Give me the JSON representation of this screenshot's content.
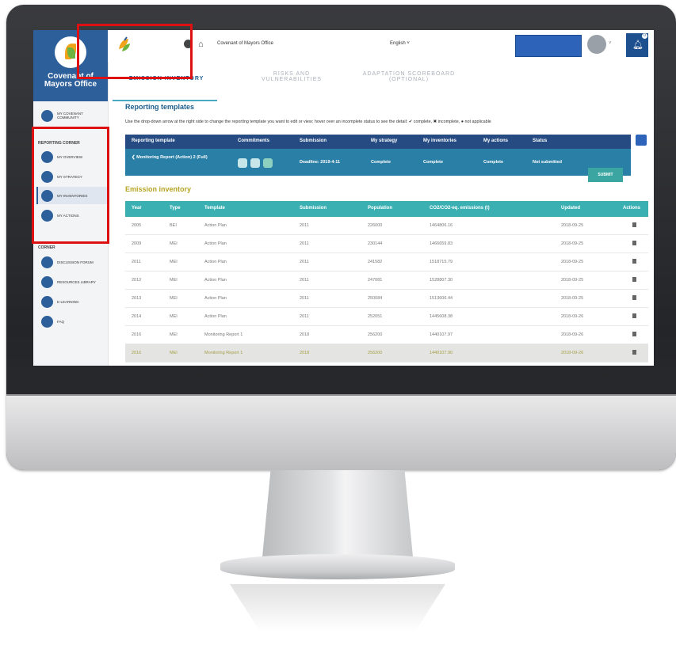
{
  "sidebar": {
    "brand_title": "Covenant of Mayors Office",
    "brand_sub": "",
    "items_top": [
      {
        "label": "My Covenant community",
        "icon": "community-icon"
      }
    ],
    "section_reporting": "Reporting corner",
    "items_reporting": [
      {
        "label": "My overview",
        "icon": "overview-icon"
      },
      {
        "label": "My strategy",
        "icon": "strategy-icon"
      },
      {
        "label": "My inventories",
        "icon": "inventories-icon"
      },
      {
        "label": "My actions",
        "icon": "actions-icon"
      }
    ],
    "section_corner": "Corner",
    "items_corner": [
      {
        "label": "Discussion forum",
        "icon": "forum-icon"
      },
      {
        "label": "Resources library",
        "icon": "library-icon"
      },
      {
        "label": "E-learning",
        "icon": "elearning-icon"
      },
      {
        "label": "FAQ",
        "icon": "faq-icon"
      }
    ]
  },
  "topbar": {
    "site_name": "Covenant of Mayors Office",
    "language": "English ˅",
    "avatar_caret": "˅",
    "notifications_count": "0"
  },
  "tabs": [
    {
      "label": "Emission inventory",
      "active": true
    },
    {
      "label": "Risks and vulnerabilities",
      "active": false
    },
    {
      "label": "Adaptation scoreboard (optional)",
      "active": false
    }
  ],
  "reporting": {
    "title": "Reporting templates",
    "instructions": "Use the drop-down arrow at the right side to change the reporting template you want to edit or view; hover over an incomplete status to see the detail: ✔ complete, ✖ incomplete, ● not applicable",
    "headers": [
      "Reporting template",
      "Commitments",
      "Submission",
      "My strategy",
      "My inventories",
      "My actions",
      "Status"
    ],
    "row": {
      "template": "❮  Monitoring Report (Action) 2 (Full)",
      "submission": "Deadline: 2019-4-11",
      "strategy": "Complete",
      "inventories": "Complete",
      "actions": "Complete",
      "status": "Not submitted",
      "submit_label": "Submit"
    }
  },
  "emission": {
    "title": "Emission inventory",
    "headers": [
      "Year",
      "Type",
      "Template",
      "Submission",
      "Population",
      "CO2/CO2-eq. emissions (t)",
      "Updated",
      "Actions"
    ],
    "rows": [
      [
        "2005",
        "BEI",
        "Action Plan",
        "2011",
        "226000",
        "1464806.16",
        "2018-09-25"
      ],
      [
        "2009",
        "MEI",
        "Action Plan",
        "2011",
        "230144",
        "1466659.83",
        "2018-09-25"
      ],
      [
        "2011",
        "MEI",
        "Action Plan",
        "2011",
        "241582",
        "1518715.79",
        "2018-09-25"
      ],
      [
        "2012",
        "MEI",
        "Action Plan",
        "2011",
        "247081",
        "1528807.30",
        "2018-09-25"
      ],
      [
        "2013",
        "MEI",
        "Action Plan",
        "2011",
        "250084",
        "1513606.44",
        "2018-09-25"
      ],
      [
        "2014",
        "MEI",
        "Action Plan",
        "2011",
        "252051",
        "1445608.38",
        "2018-09-26"
      ],
      [
        "2016",
        "MEI",
        "Monitoring Report 1",
        "2018",
        "256200",
        "1440107.97",
        "2018-09-26"
      ],
      [
        "2016",
        "MEI",
        "Monitoring Report 1",
        "2018",
        "256200",
        "1440107.90",
        "2018-09-26"
      ]
    ]
  }
}
